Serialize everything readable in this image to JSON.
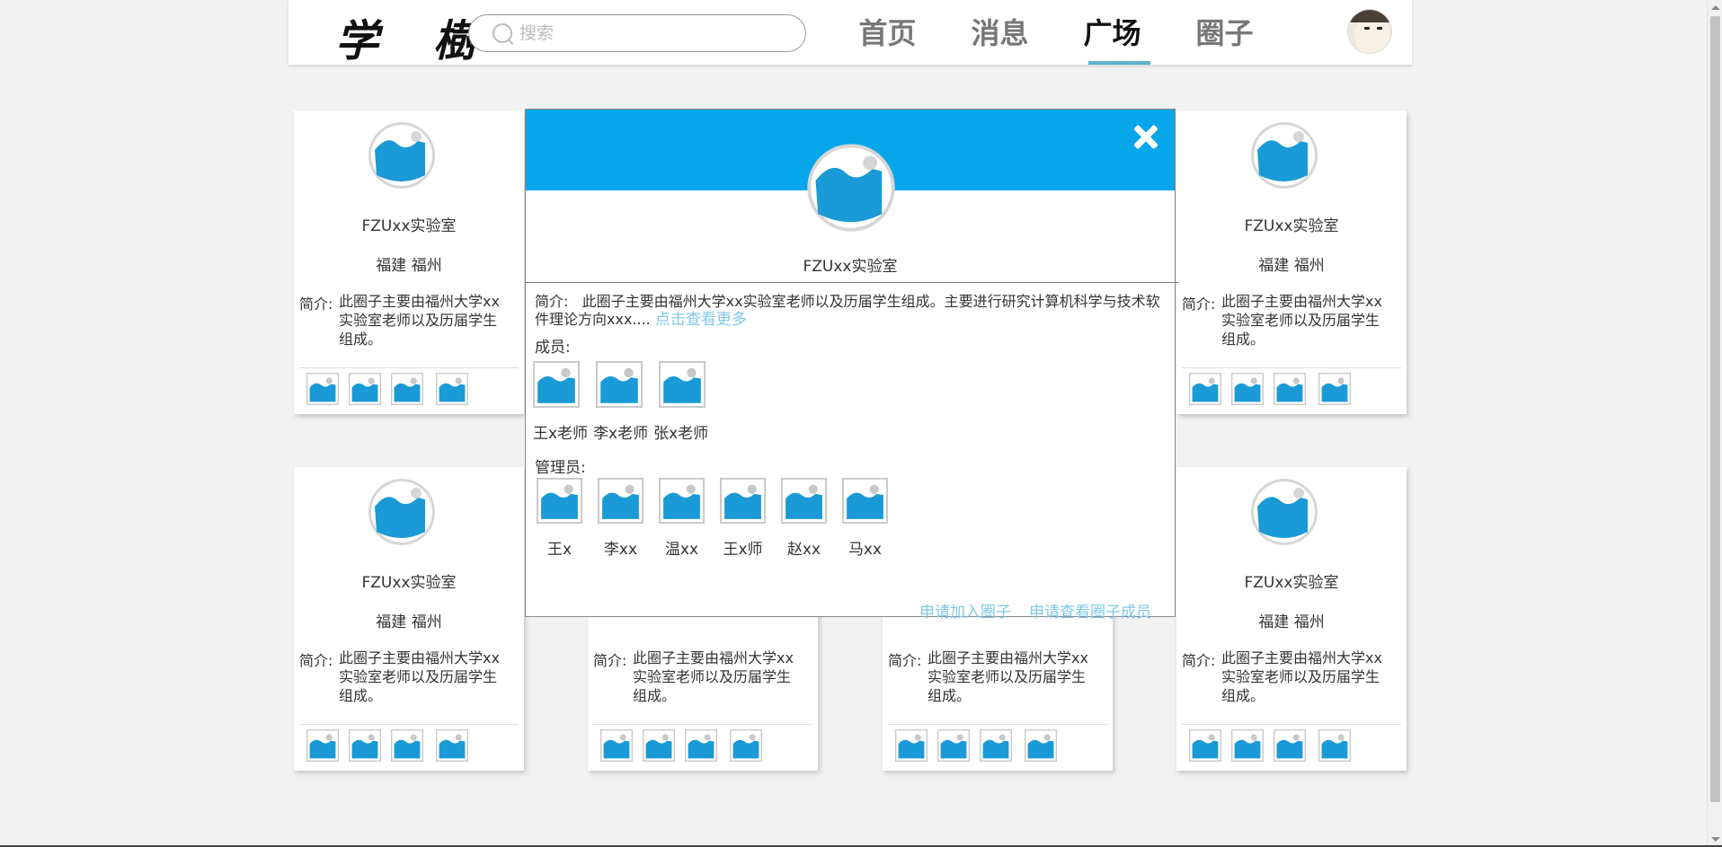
{
  "header": {
    "logo": "学 樹",
    "search_placeholder": "搜索",
    "nav": [
      "首页",
      "消息",
      "广场",
      "圈子"
    ],
    "active_nav": "广场"
  },
  "cards": [
    {
      "name": "FZUxx实验室",
      "location": "福建 福州",
      "intro_label": "简介:",
      "intro": "此圈子主要由福州大学xx实验室老师以及历届学生组成。"
    },
    {
      "name": "FZUxx实验室",
      "location": "福建 福州",
      "intro_label": "简介:",
      "intro": "此圈子主要由福州大学xx实验室老师以及历届学生组成。"
    },
    {
      "name": "FZUxx实验室",
      "location": "福建 福州",
      "intro_label": "简介:",
      "intro": "此圈子主要由福州大学xx实验室老师以及历届学生组成。"
    },
    {
      "name": "FZUxx实验室",
      "location": "福建 福州",
      "intro_label": "简介:",
      "intro": "此圈子主要由福州大学xx实验室老师以及历届学生组成。"
    },
    {
      "name": "",
      "location": "",
      "intro_label": "简介:",
      "intro": "此圈子主要由福州大学xx实验室老师以及历届学生组成。"
    },
    {
      "name": "",
      "location": "",
      "intro_label": "简介:",
      "intro": "此圈子主要由福州大学xx实验室老师以及历届学生组成。"
    }
  ],
  "modal": {
    "name": "FZUxx实验室",
    "intro_label": "简介:",
    "intro": "此圈子主要由福州大学xx实验室老师以及历届学生组成。主要进行研究计算机科学与技术软件理论方向xxx....",
    "more_link": "点击查看更多",
    "members_label": "成员:",
    "members": [
      "王x老师",
      "李x老师",
      "张x老师"
    ],
    "admins_label": "管理员:",
    "admins": [
      "王x",
      "李xx",
      "温xx",
      "王x师",
      "赵xx",
      "马xx"
    ],
    "actions": [
      "申请加入圈子",
      "申请查看圈子成员"
    ]
  },
  "colors": {
    "banner": "#07a6ea",
    "link": "#7ec8e8",
    "image_icon": "#1a9ad6",
    "nav_underline": "#5bb3c8"
  },
  "icons": {
    "placeholder": "image-placeholder-icon",
    "close": "close-icon",
    "search": "search-icon"
  }
}
